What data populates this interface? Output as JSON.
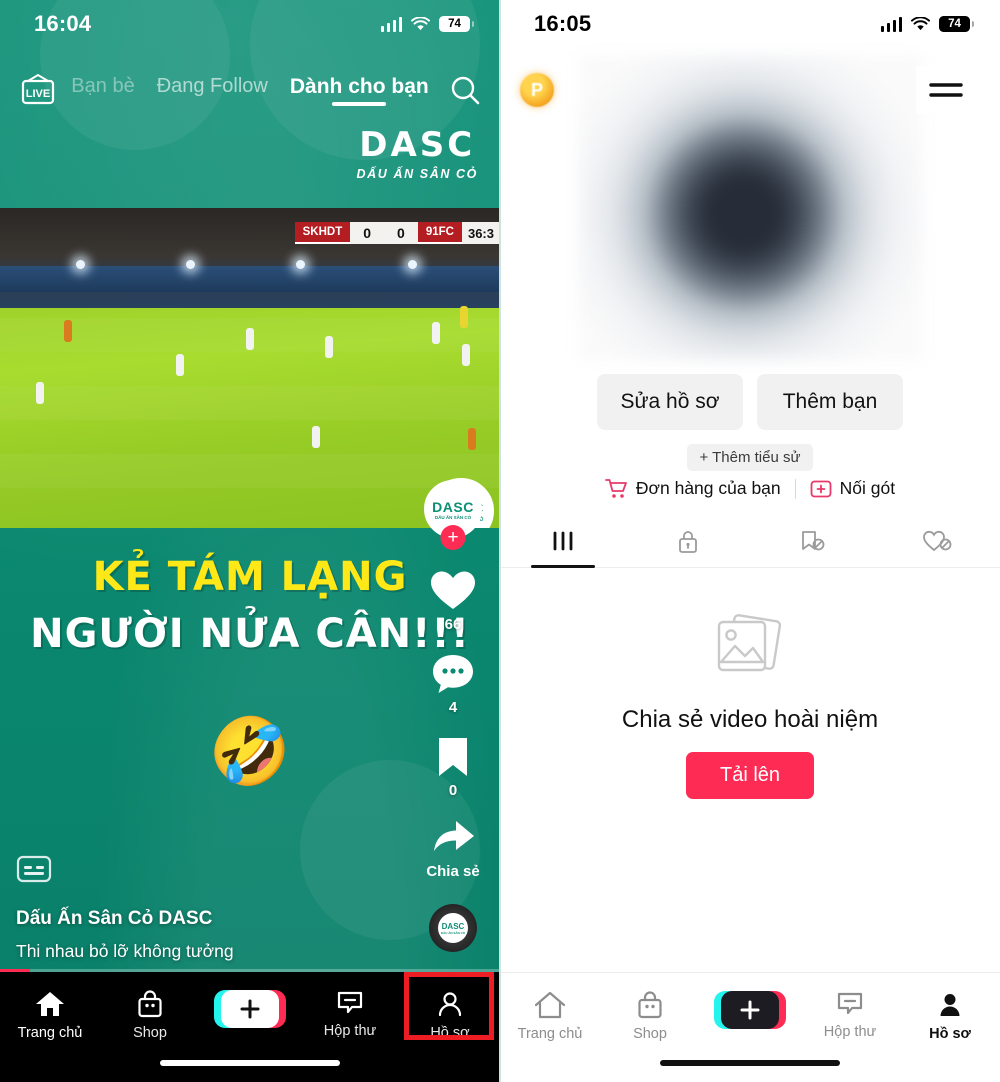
{
  "left_phone": {
    "status_bar": {
      "clock": "16:04",
      "battery": "74",
      "signal_icon": "cellular-signal-icon",
      "wifi_icon": "wifi-icon",
      "battery_icon": "battery-icon"
    },
    "top_tabs": {
      "live_icon": "live-tv-icon",
      "search_icon": "search-icon",
      "tabs": [
        {
          "label": "Bạn bè",
          "active": false
        },
        {
          "label": "Đang Follow",
          "active": false
        },
        {
          "label": "Dành cho bạn",
          "active": true
        }
      ]
    },
    "brand": {
      "main": "DASC",
      "sub": "DẤU ẤN SÂN CỎ"
    },
    "scoreboard": {
      "home": "SKHDT",
      "home_score": "0",
      "away_score": "0",
      "away": "91FC",
      "time": "36:3"
    },
    "overlay": {
      "line1": "KẺ TÁM LẠNG",
      "line2": "NGƯỜI NỬA CÂN!!!",
      "emoji": "🤣"
    },
    "action_rail": {
      "avatar_name": "DASC",
      "avatar_sub": "DẤU ẤN SÂN CỎ",
      "follow_icon": "plus-follow-icon",
      "like_icon": "heart-icon",
      "like_count": "66",
      "comment_icon": "comment-icon",
      "comment_count": "4",
      "bookmark_icon": "bookmark-icon",
      "bookmark_count": "0",
      "share_icon": "share-arrow-icon",
      "share_label": "Chia sẻ",
      "disc_label": "DASC",
      "disc_sub": "DẤU ẤN SÂN CỎ"
    },
    "caption": {
      "author": "Dấu Ấn Sân Cỏ DASC",
      "text": "Thi nhau bỏ lỡ không tưởng",
      "cc_icon": "closed-caption-icon"
    },
    "bottom_nav": [
      {
        "label": "Trang chủ",
        "icon": "home-icon",
        "active": true
      },
      {
        "label": "Shop",
        "icon": "shop-bag-icon",
        "active": false
      },
      {
        "label": "",
        "icon": "create-plus-icon",
        "active": false
      },
      {
        "label": "Hộp thư",
        "icon": "inbox-message-icon",
        "active": false
      },
      {
        "label": "Hồ sơ",
        "icon": "profile-person-icon",
        "active": false
      }
    ],
    "highlight": {
      "target": "Hồ sơ",
      "color": "#ee1d23"
    }
  },
  "right_phone": {
    "status_bar": {
      "clock": "16:05",
      "battery": "74",
      "signal_icon": "cellular-signal-icon",
      "wifi_icon": "wifi-icon",
      "battery_icon": "battery-icon"
    },
    "p_badge": "P",
    "menu_icon": "hamburger-menu-icon",
    "actions": {
      "edit_profile": "Sửa hồ sơ",
      "add_friend": "Thêm bạn",
      "add_bio": "+ Thêm tiểu sử"
    },
    "links": [
      {
        "label": "Đơn hàng của bạn",
        "icon": "shopping-cart-icon"
      },
      {
        "label": "Nối gót",
        "icon": "add-box-icon"
      }
    ],
    "tabs": [
      {
        "icon": "grid-posts-icon",
        "active": true
      },
      {
        "icon": "lock-private-icon",
        "active": false
      },
      {
        "icon": "bookmark-hidden-icon",
        "active": false
      },
      {
        "icon": "heart-hidden-icon",
        "active": false
      }
    ],
    "empty_state": {
      "icon": "photo-stack-icon",
      "title": "Chia sẻ video hoài niệm",
      "button": "Tải lên"
    },
    "bottom_nav": [
      {
        "label": "Trang chủ",
        "icon": "home-icon",
        "active": false
      },
      {
        "label": "Shop",
        "icon": "shop-bag-icon",
        "active": false
      },
      {
        "label": "",
        "icon": "create-plus-icon",
        "active": false
      },
      {
        "label": "Hộp thư",
        "icon": "inbox-message-icon",
        "active": false
      },
      {
        "label": "Hồ sơ",
        "icon": "profile-person-icon",
        "active": true
      }
    ],
    "highlight": {
      "target": "hamburger-menu-icon",
      "color": "#ee1d23"
    }
  }
}
